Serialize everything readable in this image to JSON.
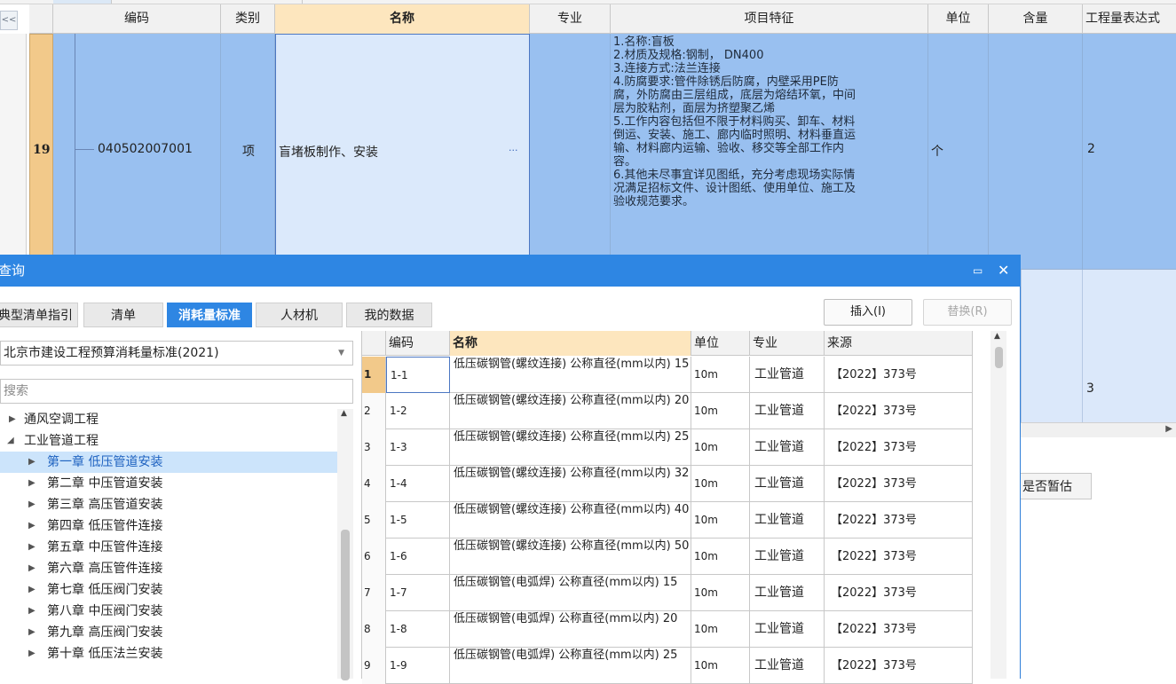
{
  "main_table": {
    "collapse_label": "<<",
    "headers": {
      "code": "编码",
      "category": "类别",
      "name": "名称",
      "specialty": "专业",
      "features": "项目特征",
      "unit": "单位",
      "content": "含量",
      "expression": "工程量表达式"
    },
    "row": {
      "index": "19",
      "code": "040502007001",
      "category": "项",
      "name": "盲堵板制作、安装",
      "ellipsis": "···",
      "features": "1.名称:盲板\n2.材质及规格:钢制， DN400\n3.连接方式:法兰连接\n4.防腐要求:管件除锈后防腐，内壁采用PE防\n腐，外防腐由三层组成，底层为熔结环氧，中间\n层为胶粘剂，面层为挤塑聚乙烯\n5.工作内容包括但不限于材料购买、卸车、材料\n倒运、安装、施工、廊内临时照明、材料垂直运\n输、材料廊内运输、验收、移交等全部工作内\n容。\n6.其他未尽事宜详见图纸，充分考虑现场实际情\n况满足招标文件、设计图纸、使用单位、施工及\n验收规范要求。",
      "unit": "个",
      "expression": "2"
    },
    "row2_value": "3",
    "estimate_label": "是否暂估"
  },
  "dialog": {
    "title": "查询",
    "restore_icon": "restore-icon",
    "close_icon": "close-icon",
    "tabs": [
      "典型清单指引",
      "清单",
      "消耗量标准",
      "人材机",
      "我的数据"
    ],
    "active_tab": 2,
    "insert_label": "插入(I)",
    "replace_label": "替换(R)",
    "library": "北京市建设工程预算消耗量标准(2021)",
    "search_placeholder": "搜索",
    "tree": [
      {
        "label": "通风空调工程",
        "level": 0,
        "expanded": false
      },
      {
        "label": "工业管道工程",
        "level": 0,
        "expanded": true
      },
      {
        "label": "第一章 低压管道安装",
        "level": 1,
        "selected": true
      },
      {
        "label": "第二章 中压管道安装",
        "level": 1
      },
      {
        "label": "第三章 高压管道安装",
        "level": 1
      },
      {
        "label": "第四章 低压管件连接",
        "level": 1
      },
      {
        "label": "第五章 中压管件连接",
        "level": 1
      },
      {
        "label": "第六章 高压管件连接",
        "level": 1
      },
      {
        "label": "第七章 低压阀门安装",
        "level": 1
      },
      {
        "label": "第八章 中压阀门安装",
        "level": 1
      },
      {
        "label": "第九章 高压阀门安装",
        "level": 1
      },
      {
        "label": "第十章 低压法兰安装",
        "level": 1
      }
    ],
    "grid": {
      "headers": [
        "编码",
        "名称",
        "单位",
        "专业",
        "来源"
      ],
      "rows": [
        {
          "num": "1",
          "code": "1-1",
          "name": "低压碳钢管(螺纹连接) 公称直径(mm以内) 15",
          "unit": "10m",
          "major": "工业管道",
          "src": "【2022】373号"
        },
        {
          "num": "2",
          "code": "1-2",
          "name": "低压碳钢管(螺纹连接) 公称直径(mm以内) 20",
          "unit": "10m",
          "major": "工业管道",
          "src": "【2022】373号"
        },
        {
          "num": "3",
          "code": "1-3",
          "name": "低压碳钢管(螺纹连接) 公称直径(mm以内) 25",
          "unit": "10m",
          "major": "工业管道",
          "src": "【2022】373号"
        },
        {
          "num": "4",
          "code": "1-4",
          "name": "低压碳钢管(螺纹连接) 公称直径(mm以内) 32",
          "unit": "10m",
          "major": "工业管道",
          "src": "【2022】373号"
        },
        {
          "num": "5",
          "code": "1-5",
          "name": "低压碳钢管(螺纹连接) 公称直径(mm以内) 40",
          "unit": "10m",
          "major": "工业管道",
          "src": "【2022】373号"
        },
        {
          "num": "6",
          "code": "1-6",
          "name": "低压碳钢管(螺纹连接) 公称直径(mm以内) 50",
          "unit": "10m",
          "major": "工业管道",
          "src": "【2022】373号"
        },
        {
          "num": "7",
          "code": "1-7",
          "name": "低压碳钢管(电弧焊) 公称直径(mm以内) 15",
          "unit": "10m",
          "major": "工业管道",
          "src": "【2022】373号"
        },
        {
          "num": "8",
          "code": "1-8",
          "name": "低压碳钢管(电弧焊) 公称直径(mm以内) 20",
          "unit": "10m",
          "major": "工业管道",
          "src": "【2022】373号"
        },
        {
          "num": "9",
          "code": "1-9",
          "name": "低压碳钢管(电弧焊) 公称直径(mm以内) 25",
          "unit": "10m",
          "major": "工业管道",
          "src": "【2022】373号"
        }
      ]
    }
  },
  "colors": {
    "accent": "#2e86e3",
    "row_selected": "#99c0f0",
    "header_selected": "#fde6be",
    "row_number": "#f2c98a",
    "tree_selected": "#cce4fb"
  }
}
